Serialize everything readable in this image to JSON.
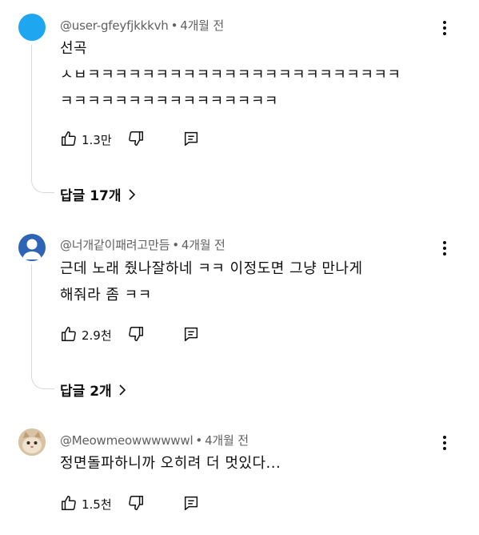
{
  "comments": [
    {
      "author": "@user-gfeyfjkkkvh",
      "time": "4개월 전",
      "lines": [
        "선곡",
        "ㅅㅂㅋㅋㅋㅋㅋㅋㅋㅋㅋㅋㅋㅋㅋㅋㅋㅋㅋㅋㅋㅋㅋㅋㅋ",
        "ㅋㅋㅋㅋㅋㅋㅋㅋㅋㅋㅋㅋㅋㅋㅋㅋ"
      ],
      "likes": "1.3만",
      "replies": "답글 17개",
      "avatar_color": "#1ea7f0"
    },
    {
      "author": "@너개같이패려고만듬",
      "time": "4개월 전",
      "lines": [
        "근데 노래 줬나잘하네 ㅋㅋ 이정도면 그냥 만나게",
        "해줘라 좀 ㅋㅋ"
      ],
      "likes": "2.9천",
      "replies": "답글 2개",
      "avatar_color": "#2f63b6"
    },
    {
      "author": "@Meowmeowwwwwwl",
      "time": "4개월 전",
      "lines": [
        "정면돌파하니까 오히려 더 멋있다..."
      ],
      "likes": "1.5천",
      "avatar_color": "#c8a98a"
    }
  ],
  "separator": "•",
  "icons": {
    "like": "thumbs-up-icon",
    "dislike": "thumbs-down-icon",
    "reply": "reply-comment-icon",
    "more": "more-vert-icon",
    "chevron": "chevron-right-icon"
  }
}
